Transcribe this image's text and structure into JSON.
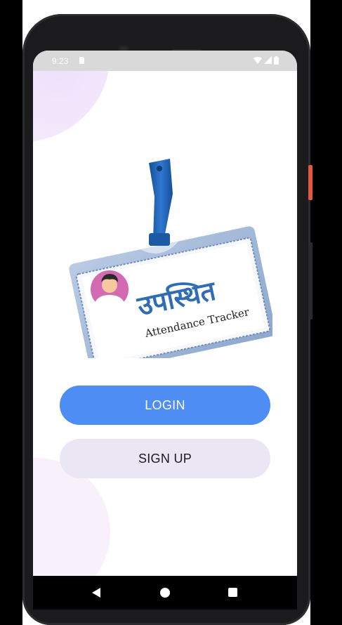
{
  "status_bar": {
    "time": "9:23",
    "icons": [
      "sim-icon",
      "wifi-icon",
      "signal-icon",
      "battery-icon"
    ]
  },
  "logo": {
    "title_hindi": "उपस्थित",
    "subtitle": "Attendance Tracker"
  },
  "buttons": {
    "login_label": "LOGIN",
    "signup_label": "SIGN UP"
  },
  "nav_bar": {
    "items": [
      "back-icon",
      "home-icon",
      "recents-icon"
    ]
  },
  "colors": {
    "login_bg": "#4e8df4",
    "signup_bg": "#ebe6f3",
    "badge_blue": "#2f6db5",
    "lanyard": "#1f5fae"
  }
}
